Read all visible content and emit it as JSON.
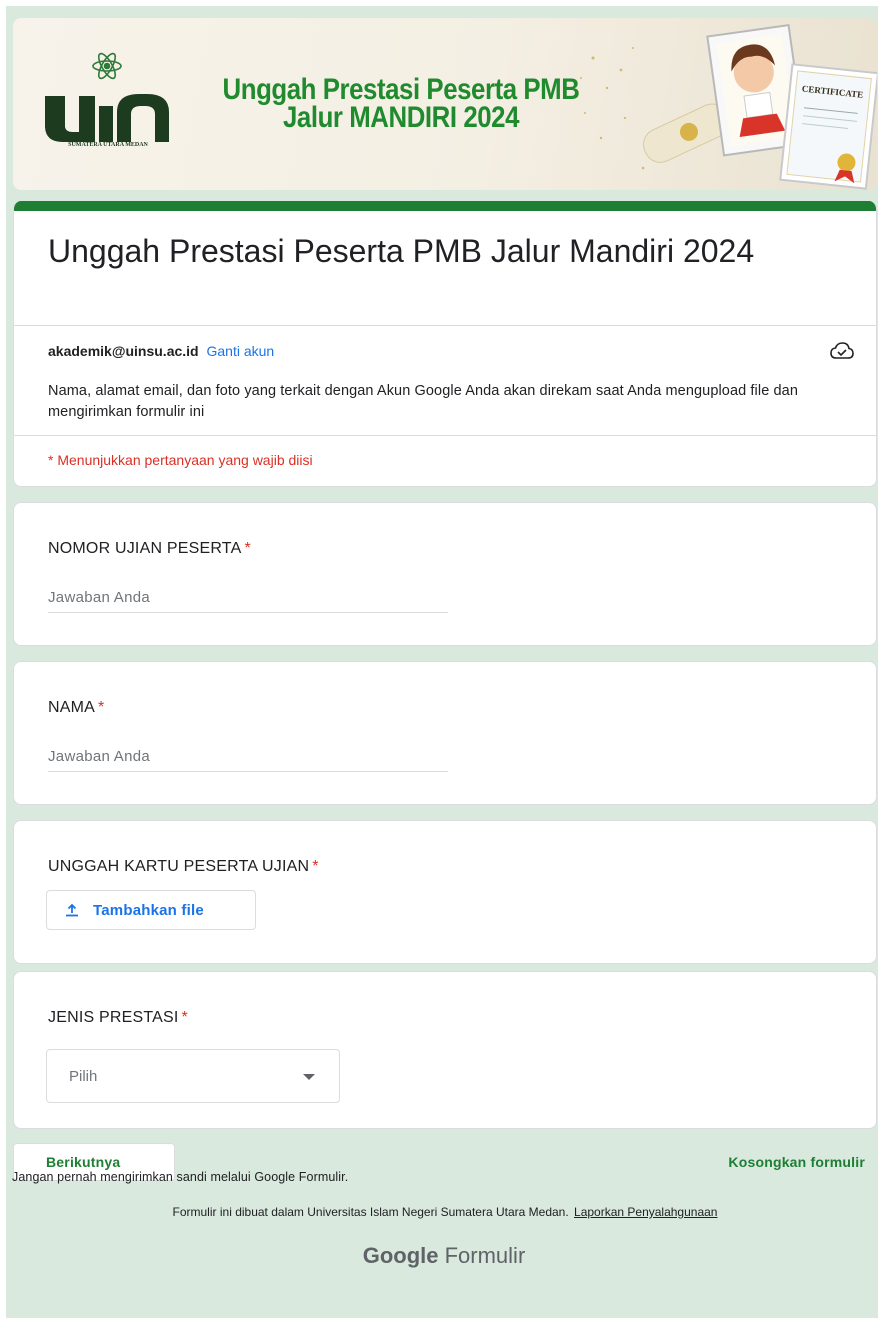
{
  "banner": {
    "title_line1": "Unggah Prestasi Peserta PMB",
    "title_line2": "Jalur MANDIRI 2024",
    "logo_text": "UIN",
    "logo_subtitle": "SUMATERA UTARA MEDAN",
    "certificate_label": "CERTIFICATE"
  },
  "form": {
    "title": "Unggah Prestasi Peserta PMB Jalur Mandiri 2024",
    "account_email": "akademik@uinsu.ac.id",
    "switch_account": "Ganti akun",
    "account_note": "Nama, alamat email, dan foto yang terkait dengan Akun Google Anda akan direkam saat Anda mengupload file dan mengirimkan formulir ini",
    "required_note": "* Menunjukkan pertanyaan yang wajib diisi"
  },
  "questions": [
    {
      "label": "NOMOR UJIAN PESERTA",
      "required": "*",
      "placeholder": "Jawaban Anda"
    },
    {
      "label": "NAMA",
      "required": "*",
      "placeholder": "Jawaban Anda"
    },
    {
      "label": "UNGGAH KARTU PESERTA UJIAN",
      "required": "*",
      "button": "Tambahkan file"
    },
    {
      "label": "JENIS PRESTASI",
      "required": "*",
      "select_value": "Pilih"
    }
  ],
  "actions": {
    "next": "Berikutnya",
    "clear": "Kosongkan formulir"
  },
  "footer": {
    "warning": "Jangan pernah mengirimkan sandi melalui Google Formulir.",
    "made_in": "Formulir ini dibuat dalam Universitas Islam Negeri Sumatera Utara Medan.",
    "report": "Laporkan Penyalahgunaan",
    "brand_google": "Google",
    "brand_forms": "Formulir"
  },
  "colors": {
    "accent": "#1e7e34",
    "background": "#d9e9dd",
    "link": "#1a73e8",
    "required": "#d93025"
  },
  "icons": [
    "cloud-check-icon",
    "upload-icon",
    "dropdown-caret-icon"
  ]
}
